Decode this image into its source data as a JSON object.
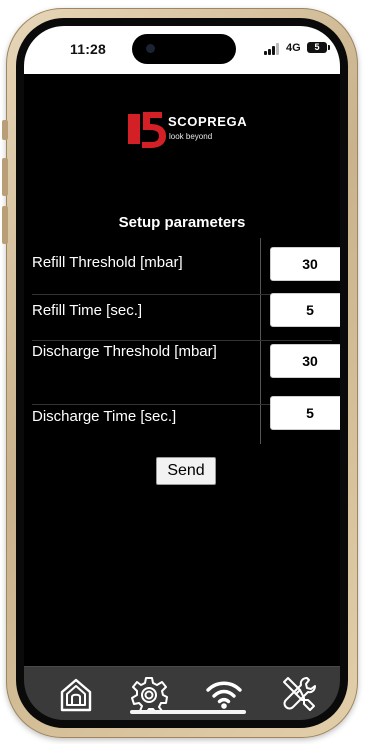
{
  "status_bar": {
    "time": "11:28",
    "network": "4G",
    "battery": "5"
  },
  "brand": {
    "name": "SCOPREGA",
    "tagline": "look beyond",
    "accent_color": "#d31f26"
  },
  "setup": {
    "title": "Setup parameters",
    "parameters": [
      {
        "label": "Refill Threshold [mbar]",
        "value": "30"
      },
      {
        "label": "Refill Time [sec.]",
        "value": "5"
      },
      {
        "label": "Discharge Threshold [mbar]",
        "value": "30"
      },
      {
        "label": "Discharge Time [sec.]",
        "value": "5"
      }
    ],
    "send_label": "Send"
  },
  "tab_bar": {
    "items": [
      {
        "icon": "home-icon"
      },
      {
        "icon": "gear-icon"
      },
      {
        "icon": "wifi-icon"
      },
      {
        "icon": "tools-icon"
      }
    ]
  }
}
